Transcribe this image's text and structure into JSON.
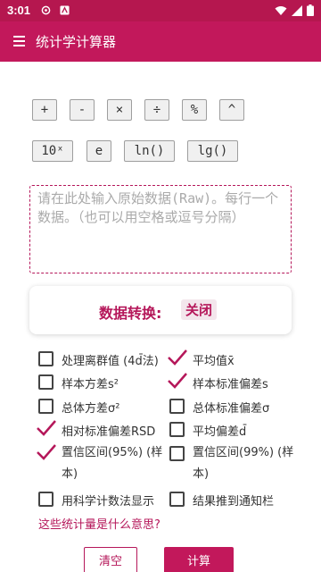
{
  "status": {
    "time": "3:01"
  },
  "app_bar": {
    "title": "统计学计算器"
  },
  "keys_row1": [
    "+",
    "-",
    "×",
    "÷",
    "%",
    "^"
  ],
  "keys_row2": [
    "10ˣ",
    "e",
    "ln()",
    "lg()"
  ],
  "input": {
    "placeholder": "请在此处输入原始数据(Raw)。每行一个数据。（也可以用空格或逗号分隔）"
  },
  "convert": {
    "label": "数据转换:",
    "value": "关闭"
  },
  "options": {
    "outlier": "处理离群值 (4d̄法)",
    "mean": "平均值x̄",
    "sample_variance": "样本方差s²",
    "sample_sd": "样本标准偏差s",
    "pop_variance": "总体方差σ²",
    "pop_sd": "总体标准偏差σ",
    "rsd": "相对标准偏差RSD",
    "mean_dev": "平均偏差d̄",
    "ci95": "置信区间(95%) (样本)",
    "ci99": "置信区间(99%) (样本)",
    "sci": "用科学计数法显示",
    "notify": "结果推到通知栏"
  },
  "help_link": "这些统计量是什么意思?",
  "buttons": {
    "clear": "清空",
    "calculate": "计算"
  },
  "colors": {
    "primary": "#c2185b",
    "status_bar": "#b5174f",
    "accent": "#b5175a"
  }
}
